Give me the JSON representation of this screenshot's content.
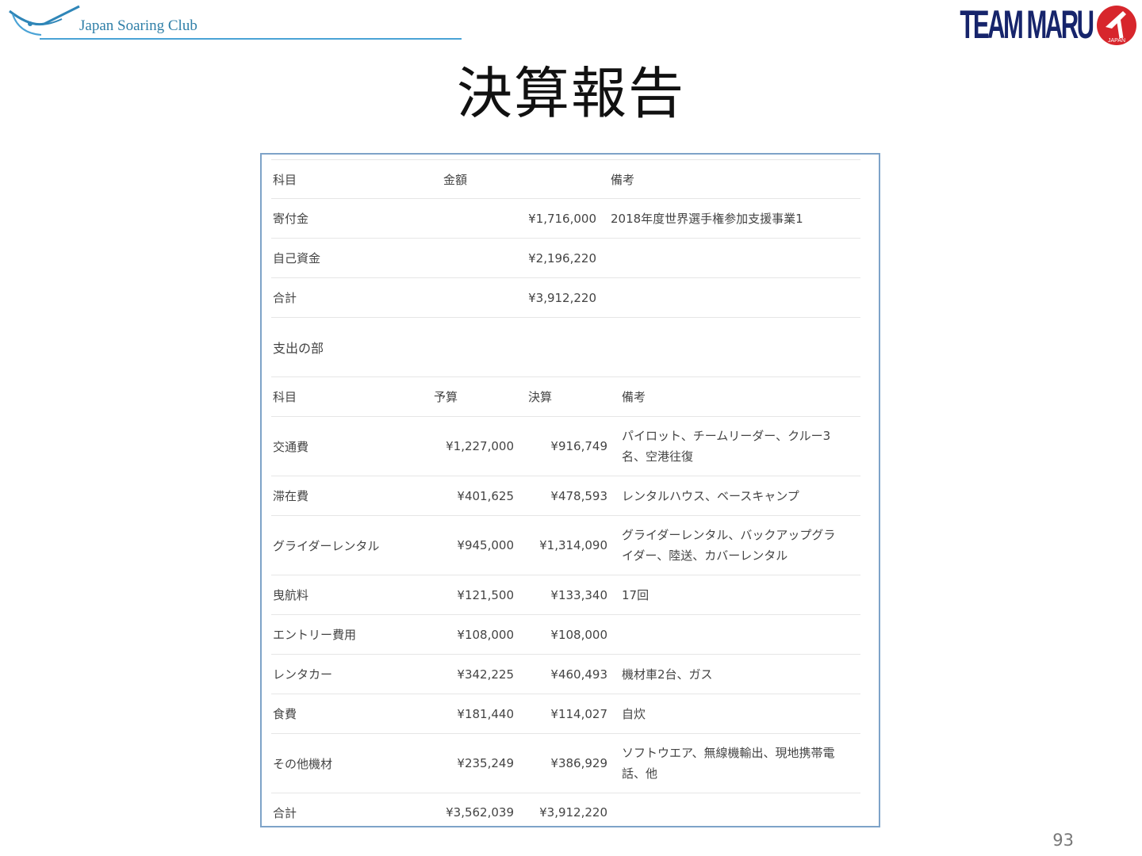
{
  "header": {
    "club_logo_text": "Japan Soaring Club",
    "team_logo_text": "TEAM MARU",
    "team_logo_sub": "JAPAN"
  },
  "title": "決算報告",
  "income": {
    "headers": [
      "科目",
      "金額",
      "備考"
    ],
    "rows": [
      {
        "item": "寄付金",
        "amount": "¥1,716,000",
        "note": "2018年度世界選手権参加支援事業1"
      },
      {
        "item": "自己資金",
        "amount": "¥2,196,220",
        "note": ""
      },
      {
        "item": "合計",
        "amount": "¥3,912,220",
        "note": ""
      }
    ]
  },
  "expense": {
    "section_label": "支出の部",
    "headers": [
      "科目",
      "予算",
      "決算",
      "備考"
    ],
    "rows": [
      {
        "item": "交通費",
        "budget": "¥1,227,000",
        "actual": "¥916,749",
        "note": "パイロット、チームリーダー、クルー3名、空港往復"
      },
      {
        "item": "滞在費",
        "budget": "¥401,625",
        "actual": "¥478,593",
        "note": "レンタルハウス、ベースキャンプ"
      },
      {
        "item": "グライダーレンタル",
        "budget": "¥945,000",
        "actual": "¥1,314,090",
        "note": "グライダーレンタル、バックアップグライダー、陸送、カバーレンタル"
      },
      {
        "item": "曳航料",
        "budget": "¥121,500",
        "actual": "¥133,340",
        "note": "17回"
      },
      {
        "item": "エントリー費用",
        "budget": "¥108,000",
        "actual": "¥108,000",
        "note": ""
      },
      {
        "item": "レンタカー",
        "budget": "¥342,225",
        "actual": "¥460,493",
        "note": "機材車2台、ガス"
      },
      {
        "item": "食費",
        "budget": "¥181,440",
        "actual": "¥114,027",
        "note": "自炊"
      },
      {
        "item": "その他機材",
        "budget": "¥235,249",
        "actual": "¥386,929",
        "note": "ソフトウエア、無線機輸出、現地携帯電話、他"
      },
      {
        "item": "合計",
        "budget": "¥3,562,039",
        "actual": "¥3,912,220",
        "note": ""
      }
    ]
  },
  "page_number": "93",
  "colors": {
    "frame_border": "#7ea3c8",
    "club_blue": "#4aa3d6",
    "team_navy": "#16246b",
    "team_red": "#d7262c"
  }
}
